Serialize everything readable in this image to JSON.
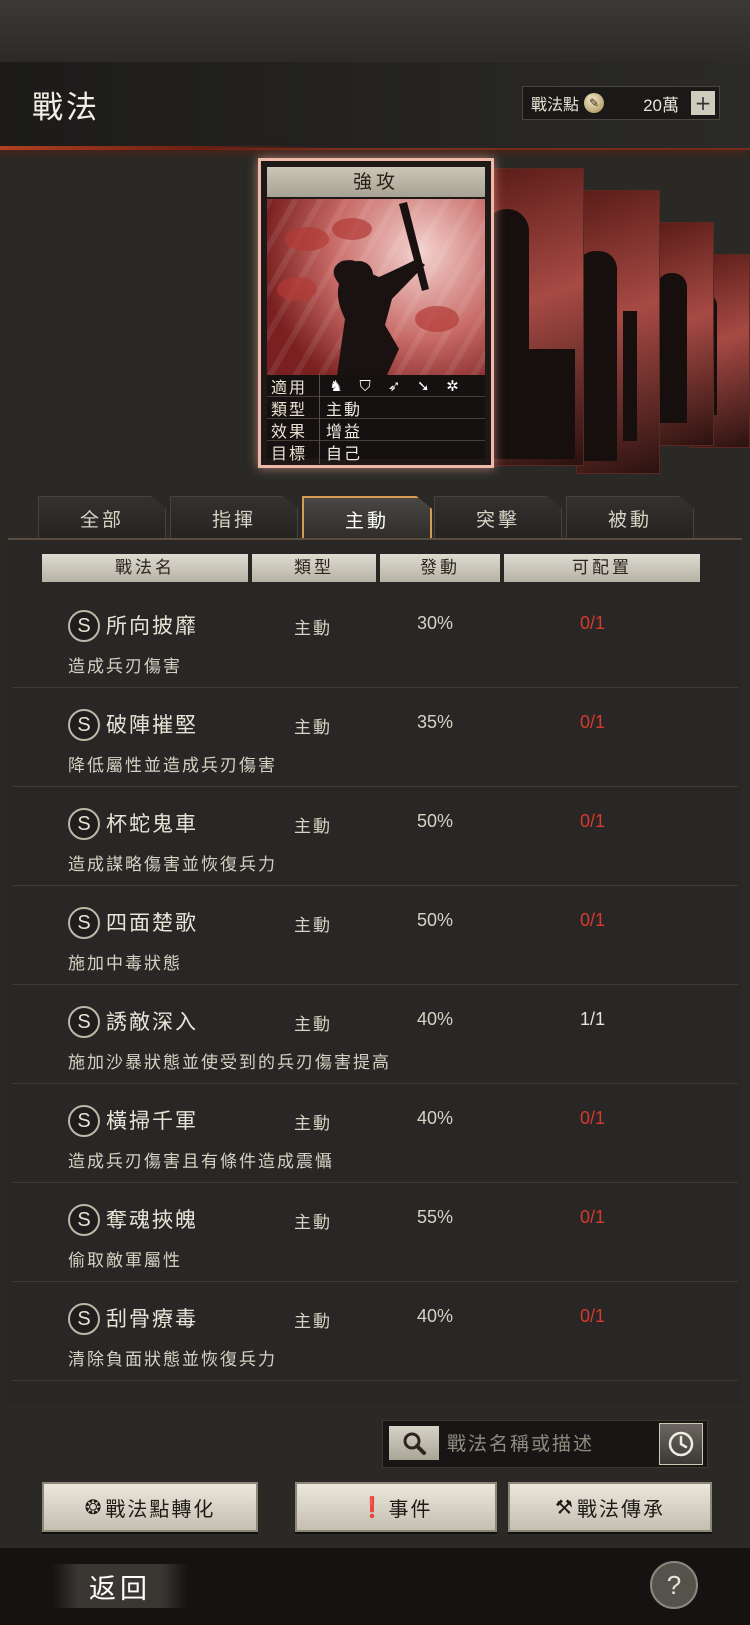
{
  "header": {
    "title": "戰法",
    "points_label": "戰法點",
    "points_value": "20萬",
    "add_symbol": "+"
  },
  "card": {
    "name": "強攻",
    "info": [
      {
        "key": "適用",
        "value": ""
      },
      {
        "key": "類型",
        "value": "主動"
      },
      {
        "key": "效果",
        "value": "增益"
      },
      {
        "key": "目標",
        "value": "自己"
      }
    ],
    "applicable_icons": [
      "cavalry-icon",
      "shield-icon",
      "bow-icon",
      "spear-icon",
      "wheel-icon"
    ]
  },
  "tabs": [
    {
      "label": "全部"
    },
    {
      "label": "指揮"
    },
    {
      "label": "主動",
      "active": true
    },
    {
      "label": "突擊"
    },
    {
      "label": "被動"
    }
  ],
  "table": {
    "headers": [
      "戰法名",
      "類型",
      "發動",
      "可配置"
    ],
    "rows": [
      {
        "grade": "S",
        "name": "所向披靡",
        "type": "主動",
        "rate": "30%",
        "slot": "0/1",
        "desc": "造成兵刃傷害"
      },
      {
        "grade": "S",
        "name": "破陣摧堅",
        "type": "主動",
        "rate": "35%",
        "slot": "0/1",
        "desc": "降低屬性並造成兵刃傷害"
      },
      {
        "grade": "S",
        "name": "杯蛇鬼車",
        "type": "主動",
        "rate": "50%",
        "slot": "0/1",
        "desc": "造成謀略傷害並恢復兵力"
      },
      {
        "grade": "S",
        "name": "四面楚歌",
        "type": "主動",
        "rate": "50%",
        "slot": "0/1",
        "desc": "施加中毒狀態"
      },
      {
        "grade": "S",
        "name": "誘敵深入",
        "type": "主動",
        "rate": "40%",
        "slot": "1/1",
        "desc": "施加沙暴狀態並使受到的兵刃傷害提高"
      },
      {
        "grade": "S",
        "name": "橫掃千軍",
        "type": "主動",
        "rate": "40%",
        "slot": "0/1",
        "desc": "造成兵刃傷害且有條件造成震懾"
      },
      {
        "grade": "S",
        "name": "奪魂挾魄",
        "type": "主動",
        "rate": "55%",
        "slot": "0/1",
        "desc": "偷取敵軍屬性"
      },
      {
        "grade": "S",
        "name": "刮骨療毒",
        "type": "主動",
        "rate": "40%",
        "slot": "0/1",
        "desc": "清除負面狀態並恢復兵力"
      }
    ]
  },
  "search": {
    "placeholder": "戰法名稱或描述"
  },
  "buttons": {
    "convert": "戰法點轉化",
    "events": "事件",
    "inherit": "戰法傳承"
  },
  "footer": {
    "back": "返回",
    "help": "?"
  },
  "colors": {
    "accent": "#d89a52",
    "slot_unavailable": "#d63a2e",
    "header_glow": "#b04020"
  }
}
